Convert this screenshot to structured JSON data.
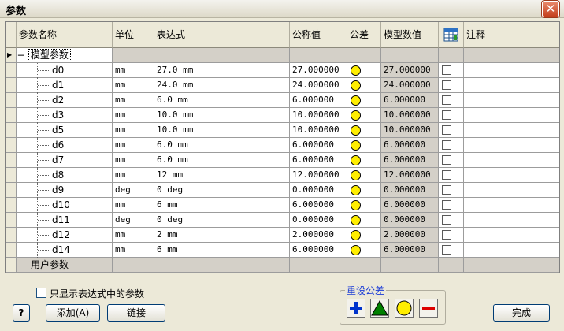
{
  "window": {
    "title": "参数",
    "close_glyph": "✕"
  },
  "table": {
    "headers": {
      "name": "参数名称",
      "unit": "单位",
      "expr": "表达式",
      "nominal": "公称值",
      "tolerance": "公差",
      "model": "模型数值",
      "comment": "注释"
    },
    "model_group": "模型参数",
    "user_group": "用户参数",
    "current_row_marker": "▶",
    "expand_glyph": "−",
    "rows": [
      {
        "name": "d0",
        "unit": "mm",
        "expr": "27.0 mm",
        "nominal": "27.000000",
        "model": "27.000000"
      },
      {
        "name": "d1",
        "unit": "mm",
        "expr": "24.0 mm",
        "nominal": "24.000000",
        "model": "24.000000"
      },
      {
        "name": "d2",
        "unit": "mm",
        "expr": "6.0 mm",
        "nominal": "6.000000",
        "model": "6.000000"
      },
      {
        "name": "d3",
        "unit": "mm",
        "expr": "10.0 mm",
        "nominal": "10.000000",
        "model": "10.000000"
      },
      {
        "name": "d5",
        "unit": "mm",
        "expr": "10.0 mm",
        "nominal": "10.000000",
        "model": "10.000000"
      },
      {
        "name": "d6",
        "unit": "mm",
        "expr": "6.0 mm",
        "nominal": "6.000000",
        "model": "6.000000"
      },
      {
        "name": "d7",
        "unit": "mm",
        "expr": "6.0 mm",
        "nominal": "6.000000",
        "model": "6.000000"
      },
      {
        "name": "d8",
        "unit": "mm",
        "expr": "12 mm",
        "nominal": "12.000000",
        "model": "12.000000"
      },
      {
        "name": "d9",
        "unit": "deg",
        "expr": "0 deg",
        "nominal": "0.000000",
        "model": "0.000000"
      },
      {
        "name": "d10",
        "unit": "mm",
        "expr": "6 mm",
        "nominal": "6.000000",
        "model": "6.000000"
      },
      {
        "name": "d11",
        "unit": "deg",
        "expr": "0 deg",
        "nominal": "0.000000",
        "model": "0.000000"
      },
      {
        "name": "d12",
        "unit": "mm",
        "expr": "2 mm",
        "nominal": "2.000000",
        "model": "2.000000"
      },
      {
        "name": "d14",
        "unit": "mm",
        "expr": "6 mm",
        "nominal": "6.000000",
        "model": "6.000000"
      }
    ]
  },
  "footer": {
    "filter_checkbox_label": "只显示表达式中的参数",
    "reset_tolerance_label": "重设公差",
    "help_glyph": "?",
    "add_label": "添加(A)",
    "link_label": "链接",
    "done_label": "完成"
  },
  "colors": {
    "tolerance_dot": "#ffee00",
    "plus": "#0033cc",
    "triangle": "#008000",
    "minus": "#dd0000"
  },
  "icons": {
    "comment_header": "spreadsheet-icon",
    "tolerance_buttons": [
      "plus-icon",
      "triangle-up-icon",
      "circle-icon",
      "minus-icon"
    ]
  }
}
